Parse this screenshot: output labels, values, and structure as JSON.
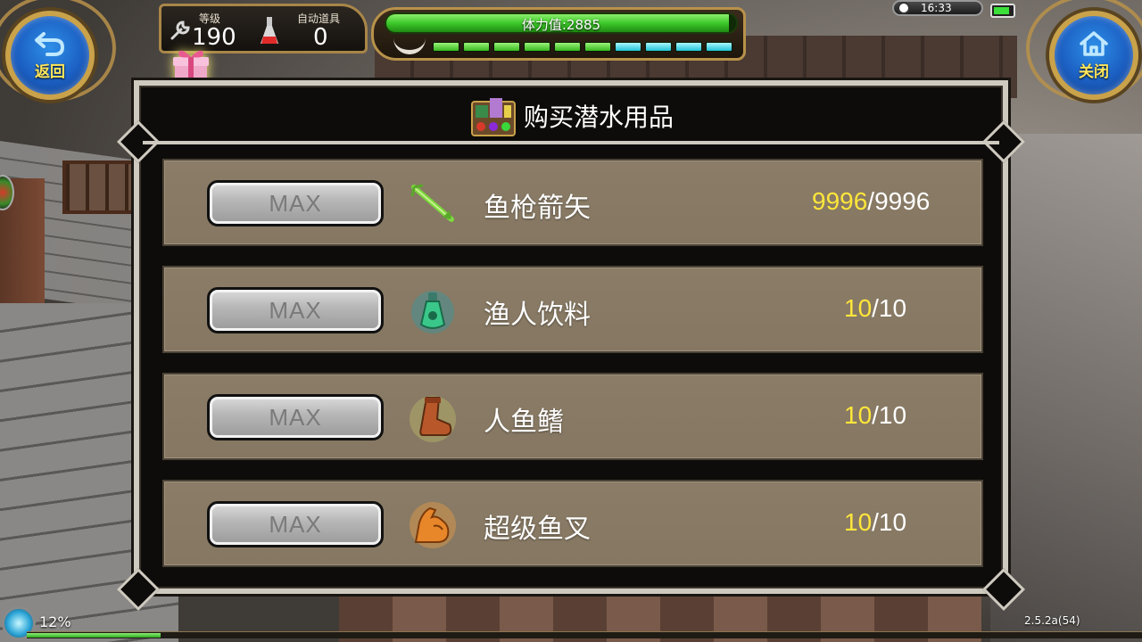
{
  "hud": {
    "back_label": "返回",
    "close_label": "关闭",
    "level_label": "等级",
    "level_value": "190",
    "auto_item_label": "自动道具",
    "auto_item_value": "0",
    "stamina_text": "体力值:2885",
    "stamina_fraction": 0.98,
    "stamina_segments": {
      "green": 6,
      "cyan": 4
    },
    "clock": "16:33",
    "battery_fraction": 0.85
  },
  "panel": {
    "title": "购买潜水用品",
    "items": [
      {
        "button_label": "MAX",
        "name": "鱼枪箭矢",
        "current": "9996",
        "max": "/9996",
        "icon": "arrow-icon"
      },
      {
        "button_label": "MAX",
        "name": "渔人饮料",
        "current": "10",
        "max": "/10",
        "icon": "potion-bottle-icon"
      },
      {
        "button_label": "MAX",
        "name": "人鱼鳍",
        "current": "10",
        "max": "/10",
        "icon": "boot-icon"
      },
      {
        "button_label": "MAX",
        "name": "超级鱼叉",
        "current": "10",
        "max": "/10",
        "icon": "muscle-arm-icon"
      }
    ]
  },
  "footer": {
    "exp_text": "12%",
    "exp_fraction": 0.12,
    "version": "2.5.2a(54)"
  },
  "colors": {
    "accent_gold": "#c9a24a",
    "count_highlight": "#ffe63a",
    "row_bg": "#8a7c66",
    "button_text": "#7a7a7a"
  }
}
